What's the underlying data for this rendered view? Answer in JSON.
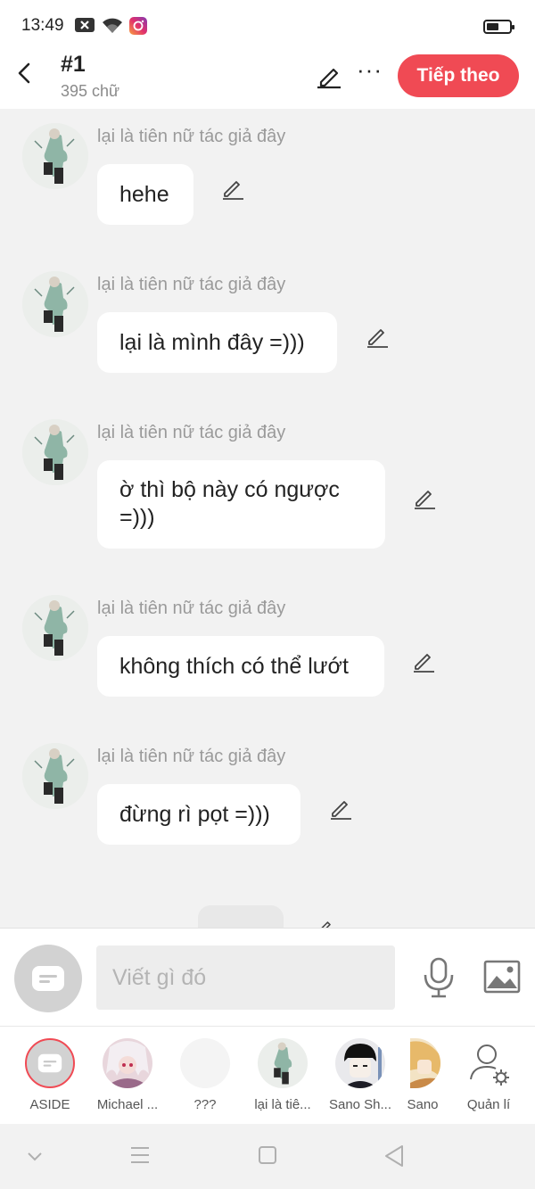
{
  "status_bar": {
    "time": "13:49",
    "battery_level": 0.55,
    "icons": [
      "notification-x-icon",
      "wifi-icon",
      "instagram-icon",
      "battery-icon"
    ]
  },
  "header": {
    "title": "#1",
    "subtitle": "395 chữ",
    "next_label": "Tiếp theo",
    "accent_color": "#f04a54"
  },
  "messages": [
    {
      "sender": "lại là tiên nữ tác giả đây",
      "text": "hehe"
    },
    {
      "sender": "lại là tiên nữ tác giả đây",
      "text": "lại là mình đây =)))"
    },
    {
      "sender": "lại là tiên nữ tác giả đây",
      "line1": "ờ thì bộ này có ngược",
      "line2": "=)))"
    },
    {
      "sender": "lại là tiên nữ tác giả đây",
      "text": "không thích có thể lướt"
    },
    {
      "sender": "lại là tiên nữ tác giả đây",
      "text": "đừng rì pọt =)))"
    }
  ],
  "composer": {
    "placeholder": "Viết gì đó"
  },
  "characters": [
    {
      "label": "ASIDE",
      "icon": "aside-icon"
    },
    {
      "label": "Michael ..."
    },
    {
      "label": "???"
    },
    {
      "label": "lại là tiê..."
    },
    {
      "label": "Sano Sh..."
    },
    {
      "label": "Sano"
    }
  ],
  "manage": {
    "label": "Quản lí",
    "icon": "user-settings-icon"
  }
}
